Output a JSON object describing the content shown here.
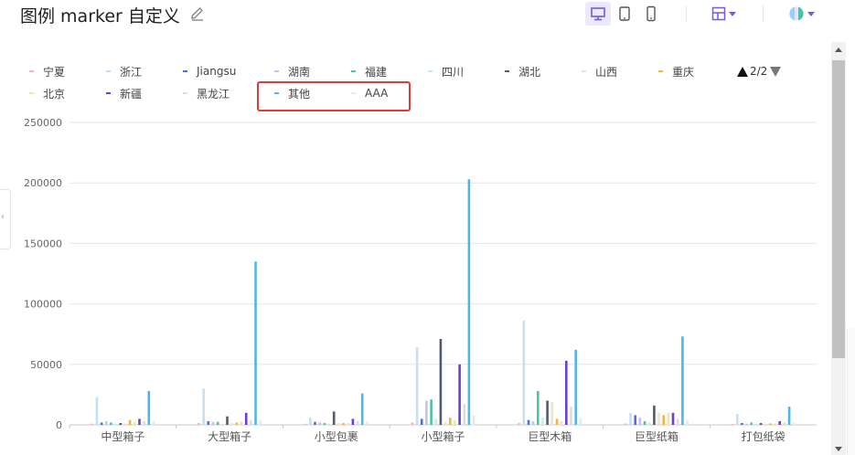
{
  "header": {
    "title": "图例 marker 自定义",
    "toolbar_icons": [
      "desktop-icon",
      "tablet-icon",
      "mobile-icon",
      "layout-icon",
      "theme-icon"
    ],
    "accent": "#7b54e8"
  },
  "legend": {
    "pager": "2/2",
    "highlighted": [
      "其他",
      "AAA"
    ]
  },
  "chart_data": {
    "type": "bar",
    "categories": [
      "中型箱子",
      "大型箱子",
      "小型包裹",
      "小型箱子",
      "巨型木箱",
      "巨型纸箱",
      "打包纸袋"
    ],
    "ylim": [
      0,
      250000
    ],
    "yticks": [
      0,
      50000,
      100000,
      150000,
      200000,
      250000
    ],
    "grid": true,
    "legend_position": "top",
    "series": [
      {
        "name": "宁夏",
        "color": "#f4b6c0",
        "values": [
          1000,
          1500,
          900,
          2000,
          1500,
          1200,
          800
        ]
      },
      {
        "name": "浙江",
        "color": "#c5dff5",
        "values": [
          23000,
          30000,
          6000,
          64000,
          86000,
          10000,
          9000
        ]
      },
      {
        "name": "Jiangsu",
        "color": "#4a6fe3",
        "values": [
          2000,
          3000,
          2500,
          5000,
          4000,
          8000,
          1500
        ]
      },
      {
        "name": "湖南",
        "color": "#c8c1f0",
        "values": [
          3000,
          2500,
          2000,
          20000,
          3000,
          6000,
          1000
        ]
      },
      {
        "name": "福建",
        "color": "#4cc4a0",
        "values": [
          2000,
          2500,
          1500,
          21000,
          28000,
          3000,
          2000
        ]
      },
      {
        "name": "四川",
        "color": "#c6ecf2",
        "values": [
          1000,
          1000,
          800,
          5000,
          6000,
          2000,
          1000
        ]
      },
      {
        "name": "湖北",
        "color": "#555b6e",
        "values": [
          1500,
          7000,
          11000,
          71000,
          20000,
          16000,
          1500
        ]
      },
      {
        "name": "山西",
        "color": "#e9e5d0",
        "values": [
          1000,
          1500,
          1500,
          2500,
          19000,
          10000,
          800
        ]
      },
      {
        "name": "重庆",
        "color": "#f5b342",
        "values": [
          4000,
          2000,
          1500,
          6000,
          5000,
          8000,
          1200
        ]
      },
      {
        "name": "北京",
        "color": "#f2e6a6",
        "values": [
          2500,
          3000,
          1500,
          4000,
          3000,
          10000,
          1000
        ]
      },
      {
        "name": "新疆",
        "color": "#6a3fd8",
        "values": [
          5000,
          10000,
          5000,
          50000,
          53000,
          10000,
          3000
        ]
      },
      {
        "name": "黑龙江",
        "color": "#dcdcdc",
        "values": [
          3000,
          4000,
          3000,
          17000,
          15000,
          5000,
          2000
        ]
      },
      {
        "name": "其他",
        "color": "#4fb6e6",
        "values": [
          28000,
          135000,
          26000,
          203000,
          62000,
          73000,
          15000
        ]
      },
      {
        "name": "AAA",
        "color": "#e9e9e9",
        "values": [
          3000,
          4000,
          2500,
          8000,
          6000,
          4000,
          2000
        ]
      }
    ]
  }
}
